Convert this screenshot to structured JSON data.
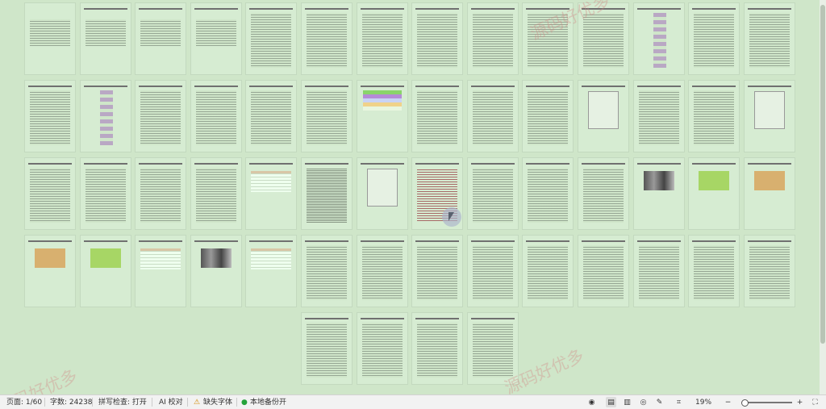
{
  "document": {
    "pages": [
      {
        "kind": "cover"
      },
      {
        "kind": "title"
      },
      {
        "kind": "title"
      },
      {
        "kind": "title"
      },
      {
        "kind": "toc"
      },
      {
        "kind": "toc"
      },
      {
        "kind": "toc"
      },
      {
        "kind": "toc"
      },
      {
        "kind": "text"
      },
      {
        "kind": "text"
      },
      {
        "kind": "text"
      },
      {
        "kind": "flow"
      },
      {
        "kind": "text"
      },
      {
        "kind": "text"
      },
      {
        "kind": "text"
      },
      {
        "kind": "flowchart"
      },
      {
        "kind": "text"
      },
      {
        "kind": "text"
      },
      {
        "kind": "text"
      },
      {
        "kind": "text"
      },
      {
        "kind": "colors"
      },
      {
        "kind": "text"
      },
      {
        "kind": "text"
      },
      {
        "kind": "text"
      },
      {
        "kind": "diagram"
      },
      {
        "kind": "text"
      },
      {
        "kind": "text"
      },
      {
        "kind": "diagram"
      },
      {
        "kind": "text"
      },
      {
        "kind": "text"
      },
      {
        "kind": "text"
      },
      {
        "kind": "text"
      },
      {
        "kind": "table"
      },
      {
        "kind": "dense"
      },
      {
        "kind": "diagram"
      },
      {
        "kind": "red"
      },
      {
        "kind": "text"
      },
      {
        "kind": "text"
      },
      {
        "kind": "text"
      },
      {
        "kind": "photo"
      },
      {
        "kind": "green"
      },
      {
        "kind": "orange"
      },
      {
        "kind": "orange"
      },
      {
        "kind": "green"
      },
      {
        "kind": "table"
      },
      {
        "kind": "photo"
      },
      {
        "kind": "table"
      },
      {
        "kind": "text"
      },
      {
        "kind": "text"
      },
      {
        "kind": "text"
      },
      {
        "kind": "text"
      },
      {
        "kind": "text"
      },
      {
        "kind": "text"
      },
      {
        "kind": "text"
      },
      {
        "kind": "text"
      },
      {
        "kind": "text"
      },
      {
        "kind": "text"
      },
      {
        "kind": "text"
      },
      {
        "kind": "text"
      },
      {
        "kind": "text"
      }
    ]
  },
  "watermarks": [
    "源码好优多",
    "源码好优多",
    "源码好优多"
  ],
  "status": {
    "page": "页面: 1/60",
    "words": "字数: 24238",
    "spellcheck": "拼写检查: 打开",
    "spellcheck_arrow": "⌄",
    "ai_check": "AI 校对",
    "missing_fonts": "缺失字体",
    "local_backup": "本地备份开",
    "zoom": "19%"
  },
  "icons": {
    "warning": "warning-icon",
    "backup": "backup-status-icon",
    "eye": "reading-mode-icon",
    "page": "page-view-icon",
    "book": "book-view-icon",
    "globe": "web-view-icon",
    "pen": "write-mode-icon",
    "fit": "fit-page-icon",
    "zoomout": "zoom-out-icon",
    "zoomin": "zoom-in-icon",
    "fullscreen": "fullscreen-icon"
  }
}
